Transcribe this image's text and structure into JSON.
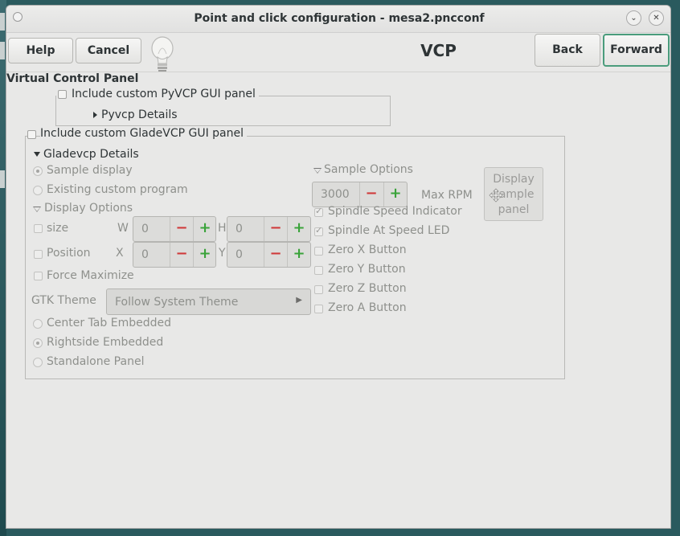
{
  "window": {
    "title": "Point and click configuration - mesa2.pncconf"
  },
  "header": {
    "help_label": "Help",
    "cancel_label": "Cancel",
    "page_title": "VCP",
    "back_label": "Back",
    "forward_label": "Forward"
  },
  "vcp": {
    "section_title": "Virtual Control Panel",
    "pyvcp_check_label": "Include custom PyVCP GUI panel",
    "pyvcp_details_label": "Pyvcp Details",
    "gladevcp_check_label": "Include custom GladeVCP GUI panel",
    "gladevcp_details_label": "Gladevcp Details",
    "sample_display_label": "Sample display",
    "existing_program_label": "Existing custom program",
    "display_options_label": "Display Options",
    "size_label": "size",
    "w_label": "W",
    "h_label": "H",
    "size_w_value": "0",
    "size_h_value": "0",
    "position_label": "Position",
    "x_label": "X",
    "y_label": "Y",
    "position_x_value": "0",
    "position_y_value": "0",
    "force_maximize_label": "Force Maximize",
    "gtk_theme_label": "GTK Theme",
    "gtk_theme_value": "Follow System Theme",
    "center_tab_label": "Center Tab Embedded",
    "rightside_label": "Rightside Embedded",
    "standalone_label": "Standalone Panel",
    "sample_options_label": "Sample Options",
    "max_rpm_value": "3000",
    "max_rpm_label": "Max RPM",
    "spindle_speed_indicator_label": "Spindle Speed Indicator",
    "spindle_at_speed_label": "Spindle At Speed LED",
    "zero_x_label": "Zero X Button",
    "zero_y_label": "Zero Y Button",
    "zero_z_label": "Zero Z Button",
    "zero_a_label": "Zero A Button",
    "display_sample_line1": "Display",
    "display_sample_line2": "sample",
    "display_sample_line3": "panel"
  },
  "colors": {
    "focus_border": "#4a9c7c",
    "minus": "#d03a3a",
    "plus": "#3aa33a"
  }
}
